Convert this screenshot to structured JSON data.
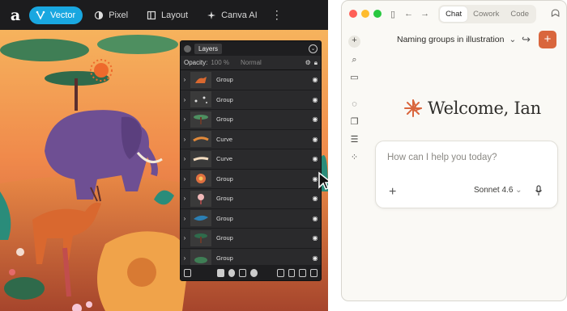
{
  "designer": {
    "logo": "a",
    "personas": [
      {
        "label": "Vector",
        "icon": "vector-icon",
        "active": true
      },
      {
        "label": "Pixel",
        "icon": "pixel-icon",
        "active": false
      },
      {
        "label": "Layout",
        "icon": "layout-icon",
        "active": false
      },
      {
        "label": "Canva AI",
        "icon": "sparkle-icon",
        "active": false
      }
    ],
    "more_icon": "kebab-icon",
    "layers_panel": {
      "tab": "Layers",
      "opacity_label": "Opacity:",
      "opacity_value": "100 %",
      "blend_mode": "Normal",
      "rows": [
        {
          "name": "Group",
          "thumb": "animal"
        },
        {
          "name": "Group",
          "thumb": "scatter"
        },
        {
          "name": "Group",
          "thumb": "tree"
        },
        {
          "name": "Curve",
          "thumb": "orange-curve"
        },
        {
          "name": "Curve",
          "thumb": "cream-curve"
        },
        {
          "name": "Group",
          "thumb": "flower"
        },
        {
          "name": "Group",
          "thumb": "bird"
        },
        {
          "name": "Group",
          "thumb": "blue-leaf"
        },
        {
          "name": "Group",
          "thumb": "plant"
        },
        {
          "name": "Group",
          "thumb": "shrub"
        }
      ]
    }
  },
  "claude": {
    "tabs": [
      {
        "label": "Chat",
        "active": true
      },
      {
        "label": "Cowork",
        "active": false
      },
      {
        "label": "Code",
        "active": false
      }
    ],
    "chat_title": "Naming groups in illustration",
    "welcome": "Welcome, Ian",
    "prompt_placeholder": "How can I help you today?",
    "model": "Sonnet 4.6",
    "colors": {
      "accent": "#d9663d",
      "active_persona": "#19a7e0"
    }
  }
}
